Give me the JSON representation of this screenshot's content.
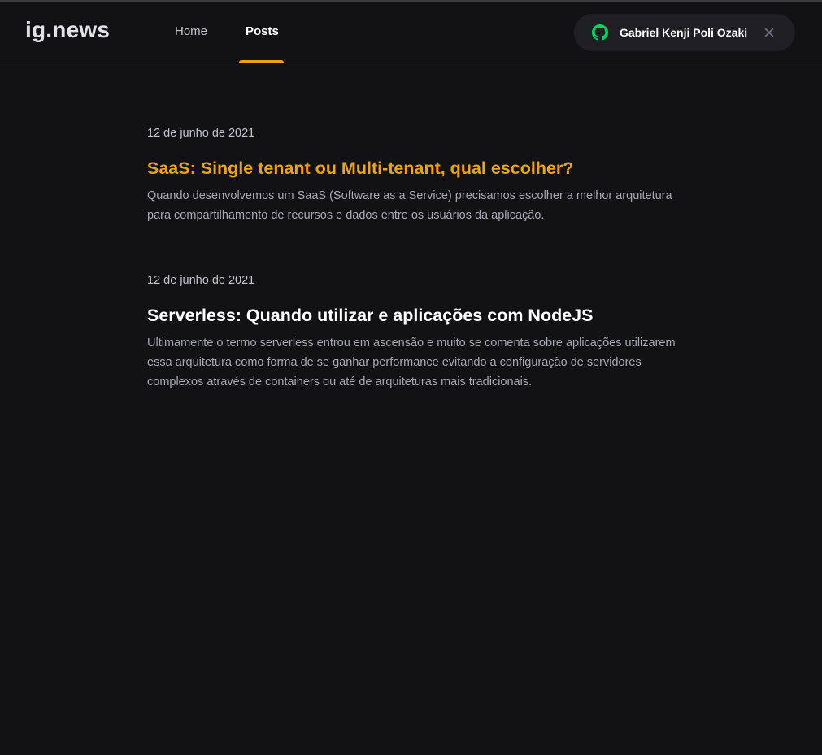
{
  "header": {
    "logo": "ig.news",
    "nav": [
      {
        "label": "Home",
        "active": false
      },
      {
        "label": "Posts",
        "active": true
      }
    ],
    "user": {
      "name": "Gabriel Kenji Poli Ozaki",
      "icon": "github-icon",
      "close_icon": "close-icon"
    }
  },
  "posts": [
    {
      "date": "12 de junho de 2021",
      "title": "SaaS: Single tenant ou Multi-tenant, qual escolher?",
      "excerpt": "Quando desenvolvemos um SaaS (Software as a Service) precisamos escolher a melhor arquitetura para compartilhamento de recursos e dados entre os usuários da aplicação."
    },
    {
      "date": "12 de junho de 2021",
      "title": "Serverless: Quando utilizar e aplicações com NodeJS",
      "excerpt": "Ultimamente o termo serverless entrou em ascensão e muito se comenta sobre aplicações utilizarem essa arquitetura como forma de se ganhar performance evitando a configuração de servidores complexos através de containers ou até de arquiteturas mais tradicionais."
    }
  ],
  "colors": {
    "background": "#121214",
    "accent": "#eba417",
    "github_green": "#04d361",
    "pill_background": "#202024"
  }
}
